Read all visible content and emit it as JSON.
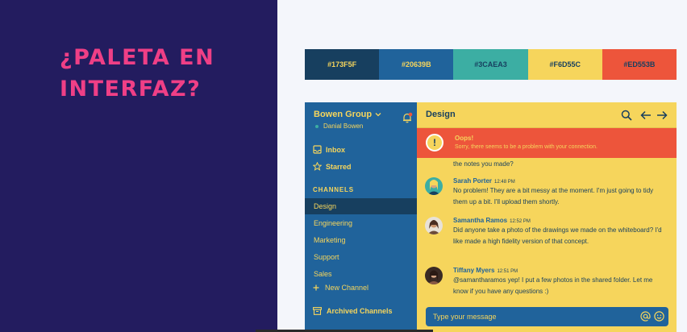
{
  "heading": {
    "line1": "¿PALETA EN",
    "line2": "INTERFAZ?"
  },
  "palette": [
    {
      "hex": "#173F5F",
      "color": "#173f5f",
      "text_color": "#f6d55c"
    },
    {
      "hex": "#20639B",
      "color": "#20639b",
      "text_color": "#f6d55c"
    },
    {
      "hex": "#3CAEA3",
      "color": "#3caea3",
      "text_color": "#173f5f"
    },
    {
      "hex": "#F6D55C",
      "color": "#f6d55c",
      "text_color": "#173f5f"
    },
    {
      "hex": "#ED553B",
      "color": "#ed553b",
      "text_color": "#173f5f"
    }
  ],
  "sidebar": {
    "group_name": "Bowen Group",
    "user_name": "Danial Bowen",
    "nav": [
      {
        "label": "Inbox",
        "icon": "inbox-icon"
      },
      {
        "label": "Starred",
        "icon": "star-icon"
      }
    ],
    "channels_title": "CHANNELS",
    "channels": [
      "Design",
      "Engineering",
      "Marketing",
      "Support",
      "Sales"
    ],
    "active_channel": "Design",
    "new_channel": "New Channel",
    "archived": "Archived Channels"
  },
  "main": {
    "title": "Design",
    "alert": {
      "title": "Oops!",
      "text": "Sorry, there seems to be a problem with your connection."
    },
    "partial_text": "the notes you made?",
    "messages": [
      {
        "author": "Sarah Porter",
        "time": "12:48 PM",
        "text": "No problem! They are a bit messy at the moment. I'm just going to tidy them up a bit. I'll upload them shortly."
      },
      {
        "author": "Samantha Ramos",
        "time": "12:52 PM",
        "text": "Did anyone take a photo of the drawings we made on the whiteboard? I'd like made a high fidelity version of that concept."
      },
      {
        "author": "Tiffany Myers",
        "time": "12:51 PM",
        "text": "@samantharamos yep! I put a few photos in the shared folder. Let me know if you have any questions :)"
      }
    ],
    "composer_placeholder": "Type your message"
  },
  "colors": {
    "left_bg": "#231c5f",
    "heading": "#ef3f86",
    "accent_yellow": "#f6d55c",
    "accent_red": "#ed553b",
    "accent_blue": "#20639b",
    "dark_blue": "#173f5f",
    "teal": "#3caea3"
  }
}
